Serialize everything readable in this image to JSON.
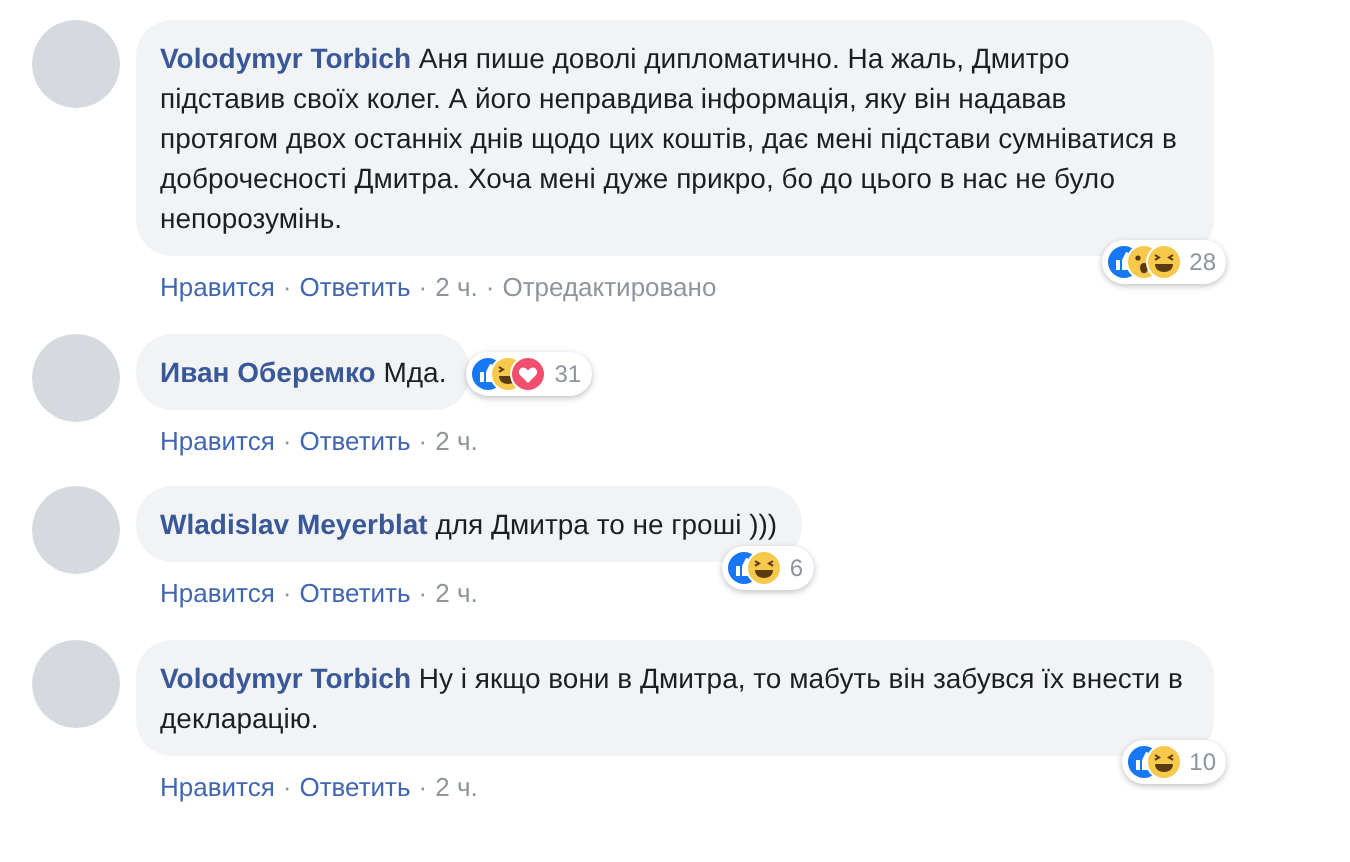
{
  "comments": [
    {
      "author": "Volodymyr Torbich",
      "text": "Аня пише доволі дипломатично. На жаль, Дмитро підставив своїх колег. А його неправдива інформація, яку він надавав протягом двох останніх днів щодо цих коштів, дає мені підстави сумніватися в доброчесності Дмитра. Хоча мені дуже прикро, бо до цього в нас не було непорозумінь.",
      "reactions": [
        {
          "kind": "like"
        },
        {
          "kind": "wow"
        },
        {
          "kind": "haha"
        }
      ],
      "reaction_count": "28",
      "actions": [
        {
          "kind": "link",
          "text": "Нравится"
        },
        {
          "kind": "dot",
          "text": "·"
        },
        {
          "kind": "link",
          "text": "Ответить"
        },
        {
          "kind": "dot",
          "text": "·"
        },
        {
          "kind": "time",
          "text": "2 ч."
        },
        {
          "kind": "dot",
          "text": "·"
        },
        {
          "kind": "note",
          "text": "Отредактировано"
        }
      ]
    },
    {
      "author": "Иван Оберемко",
      "text": "Мда.",
      "reactions": [
        {
          "kind": "like"
        },
        {
          "kind": "haha"
        },
        {
          "kind": "love"
        }
      ],
      "reaction_count": "31",
      "actions": [
        {
          "kind": "link",
          "text": "Нравится"
        },
        {
          "kind": "dot",
          "text": "·"
        },
        {
          "kind": "link",
          "text": "Ответить"
        },
        {
          "kind": "dot",
          "text": "·"
        },
        {
          "kind": "time",
          "text": "2 ч."
        }
      ]
    },
    {
      "author": "Wladislav Meyerblat",
      "text": "для Дмитра то не гроші )))",
      "reactions": [
        {
          "kind": "like"
        },
        {
          "kind": "haha"
        }
      ],
      "reaction_count": "6",
      "actions": [
        {
          "kind": "link",
          "text": "Нравится"
        },
        {
          "kind": "dot",
          "text": "·"
        },
        {
          "kind": "link",
          "text": "Ответить"
        },
        {
          "kind": "dot",
          "text": "·"
        },
        {
          "kind": "time",
          "text": "2 ч."
        }
      ]
    },
    {
      "author": "Volodymyr Torbich",
      "text": "Ну і якщо вони в Дмитра, то мабуть він забувся їх внести в декларацію.",
      "reactions": [
        {
          "kind": "like"
        },
        {
          "kind": "haha"
        }
      ],
      "reaction_count": "10",
      "actions": [
        {
          "kind": "link",
          "text": "Нравится"
        },
        {
          "kind": "dot",
          "text": "·"
        },
        {
          "kind": "link",
          "text": "Ответить"
        },
        {
          "kind": "dot",
          "text": "·"
        },
        {
          "kind": "time",
          "text": "2 ч."
        }
      ]
    }
  ]
}
